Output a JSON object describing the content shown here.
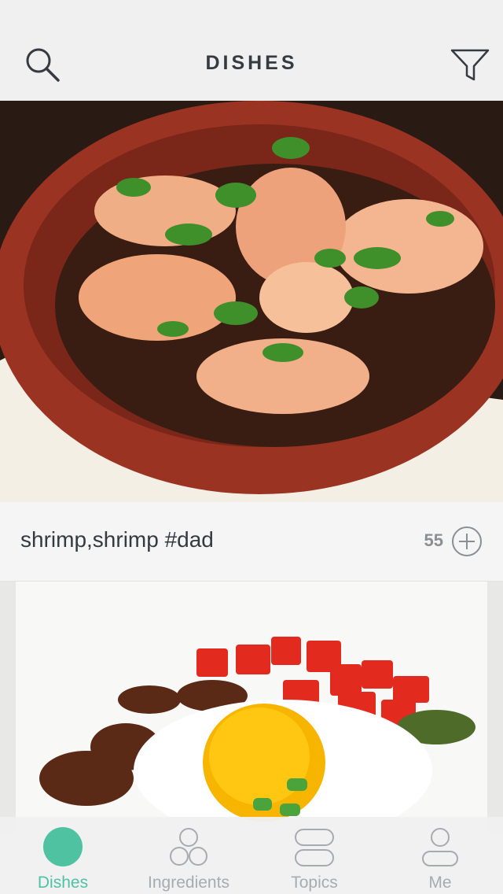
{
  "header": {
    "title": "DISHES",
    "search_icon": "search-icon",
    "filter_icon": "filter-icon"
  },
  "posts": [
    {
      "caption": "shrimp,shrimp #dad",
      "count": "55",
      "photo": "garlic shrimp in clay bowl"
    },
    {
      "caption": "",
      "count": "",
      "photo": "fried egg with tomatoes and onions"
    }
  ],
  "tabs": [
    {
      "label": "Dishes",
      "icon": "dishes-icon",
      "active": true
    },
    {
      "label": "Ingredients",
      "icon": "ingredients-icon",
      "active": false
    },
    {
      "label": "Topics",
      "icon": "topics-icon",
      "active": false
    },
    {
      "label": "Me",
      "icon": "me-icon",
      "active": false
    }
  ],
  "colors": {
    "accent": "#4fc3a1",
    "title": "#353b40",
    "muted": "#a7abb0"
  }
}
